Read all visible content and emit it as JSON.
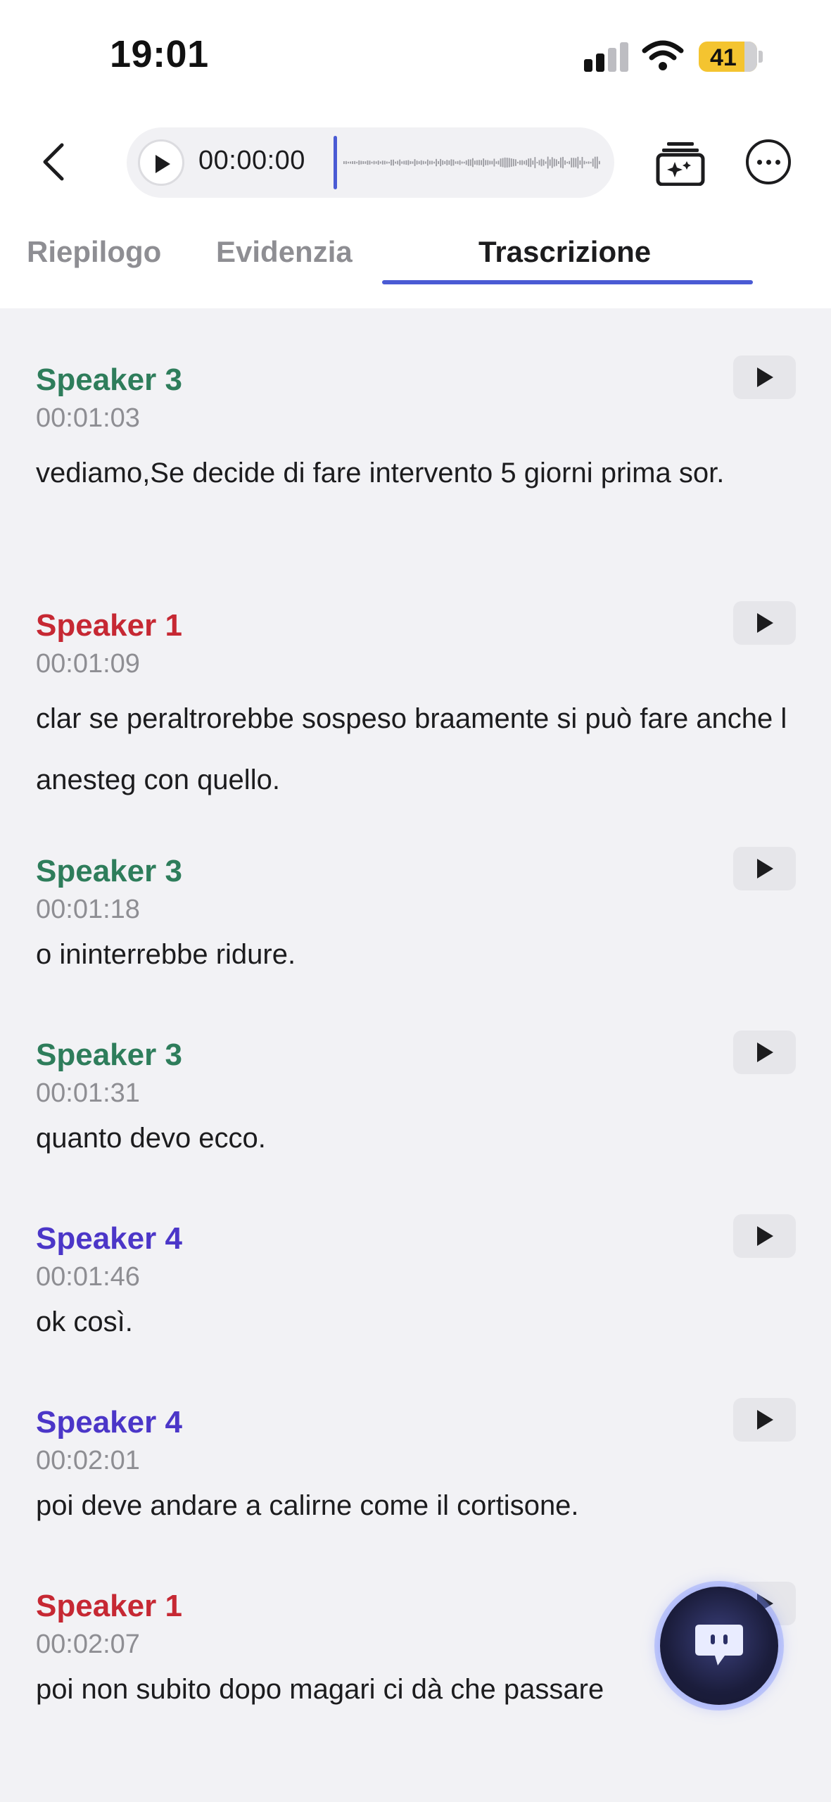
{
  "status_bar": {
    "time": "19:01",
    "battery": "41"
  },
  "player": {
    "time": "00:00:00"
  },
  "tabs": [
    {
      "label": "Riepilogo"
    },
    {
      "label": "Evidenzia"
    },
    {
      "label": "Trascrizione"
    }
  ],
  "active_tab": "Trascrizione",
  "colors": {
    "accent": "#4a5bd4",
    "speaker_3": "#2e7d5b",
    "speaker_1": "#c62833",
    "speaker_4": "#4b36c8"
  },
  "entries": [
    {
      "speaker": "Speaker 3",
      "time": "00:01:03",
      "text": " vediamo,Se decide di fare intervento 5 giorni prima sor."
    },
    {
      "speaker": "Speaker 1",
      "time": "00:01:09",
      "text": " clar se peraltrorebbe sospeso braamente si può fare anche l anesteg con quello."
    },
    {
      "speaker": "Speaker 3",
      "time": "00:01:18",
      "text": "o ininterrebbe ridure."
    },
    {
      "speaker": "Speaker 3",
      "time": "00:01:31",
      "text": "quanto devo ecco."
    },
    {
      "speaker": "Speaker 4",
      "time": "00:01:46",
      "text": "ok così."
    },
    {
      "speaker": "Speaker 4",
      "time": "00:02:01",
      "text": "poi deve andare a calirne come il cortisone."
    },
    {
      "speaker": "Speaker 1",
      "time": "00:02:07",
      "text": " poi non subito dopo magari ci dà che passare"
    }
  ],
  "icons": {
    "back": "chevron-left-icon",
    "play": "play-icon",
    "ai": "ai-summary-icon",
    "more": "more-icon",
    "chat": "chat-icon"
  }
}
